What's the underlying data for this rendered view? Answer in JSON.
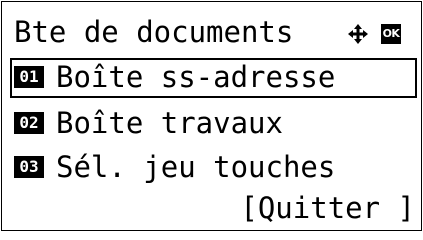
{
  "screen": {
    "title": "Bte de documents",
    "icons": {
      "navigation": "four-way-arrow-icon",
      "ok": "ok-key-icon"
    },
    "ok_label": "OK",
    "items": [
      {
        "number": "01",
        "label": "Boîte ss-adresse",
        "selected": true
      },
      {
        "number": "02",
        "label": "Boîte travaux",
        "selected": false
      },
      {
        "number": "03",
        "label": "Sél. jeu touches",
        "selected": false
      }
    ],
    "quit_label": "[Quitter ]"
  }
}
